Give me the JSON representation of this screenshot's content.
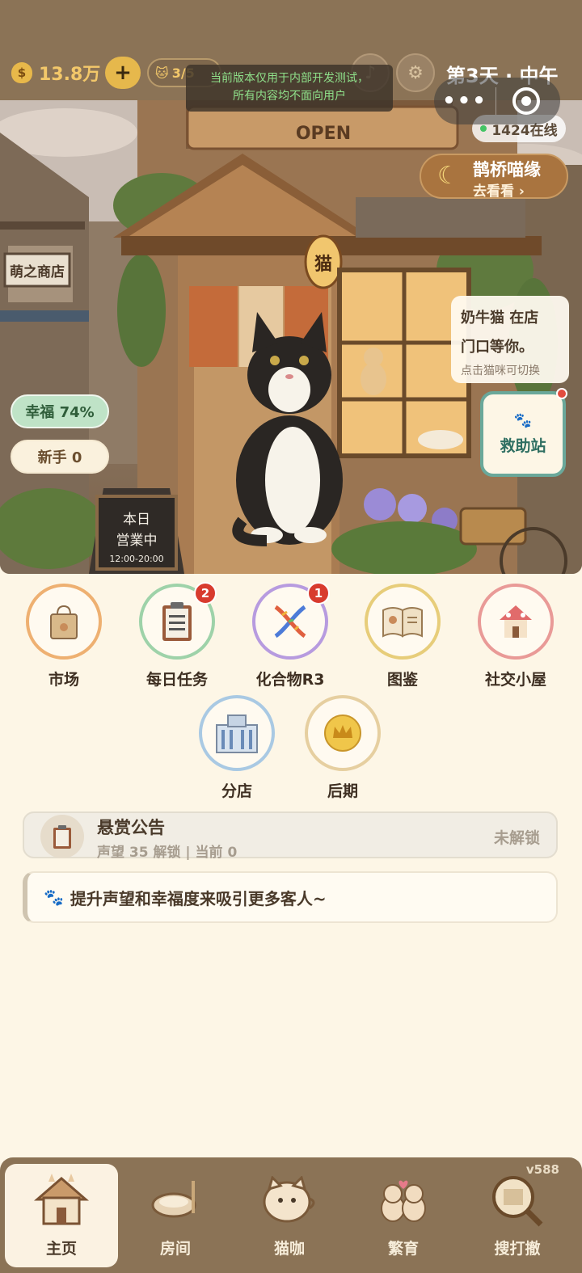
{
  "topbar": {
    "coins": "13.8万",
    "coin_icon": "$",
    "plus_label": "+",
    "cats_count": "3/5",
    "day_label": "第3天 · 中午"
  },
  "dev_notice": {
    "line1": "当前版本仅用于内部开发测试，",
    "line2": "所有内容均不面向用户"
  },
  "scene": {
    "online": "1424在线",
    "event": {
      "title": "鹊桥喵缘",
      "subtitle": "去看看 ›"
    },
    "shop_sign": "OPEN",
    "lantern": "猫",
    "board_line1": "本日",
    "board_line2": "営業中",
    "board_hours": "12:00-20:00",
    "street_sign": "萌之商店",
    "cat_bubble": {
      "line1": "奶牛猫 在店",
      "line2": "门口等你。",
      "hint": "点击猫咪可切换"
    },
    "rescue_label": "救助站",
    "happiness": "幸福 74%",
    "novice": "新手 0"
  },
  "menu": [
    {
      "label": "市场",
      "icon": "shopping-bag-icon",
      "ring": "#eeb071",
      "badge": ""
    },
    {
      "label": "每日任务",
      "icon": "clipboard-icon",
      "ring": "#9ed2a9",
      "badge": "2"
    },
    {
      "label": "化合物R3",
      "icon": "dna-icon",
      "ring": "#b79bdf",
      "badge": "1"
    },
    {
      "label": "图鉴",
      "icon": "book-icon",
      "ring": "#e7cd7a",
      "badge": ""
    },
    {
      "label": "社交小屋",
      "icon": "cottage-icon",
      "ring": "#e99a97",
      "badge": ""
    },
    {
      "label": "分店",
      "icon": "building-icon",
      "ring": "#a9c9e3",
      "badge": ""
    },
    {
      "label": "后期",
      "icon": "crown-coin-icon",
      "ring": "#e6cfa0",
      "badge": ""
    }
  ],
  "bounty": {
    "title": "悬赏公告",
    "subtitle": "声望 35 解锁 | 当前 0",
    "state": "未解锁"
  },
  "tip": "提升声望和幸福度来吸引更多客人~",
  "version": "v588",
  "nav": [
    {
      "label": "主页",
      "icon": "house-icon",
      "active": true
    },
    {
      "label": "房间",
      "icon": "cat-bed-icon",
      "active": false
    },
    {
      "label": "猫咖",
      "icon": "cat-cup-icon",
      "active": false
    },
    {
      "label": "繁育",
      "icon": "cat-pair-icon",
      "active": false
    },
    {
      "label": "搜打撤",
      "icon": "map-search-icon",
      "active": false
    }
  ],
  "colors": {
    "topbar": "#8b7356",
    "page_bg": "#fdf6e6",
    "gold": "#e6b84c",
    "rescue_border": "#6aa89a",
    "happiness_bg": "#bfe3c7"
  }
}
